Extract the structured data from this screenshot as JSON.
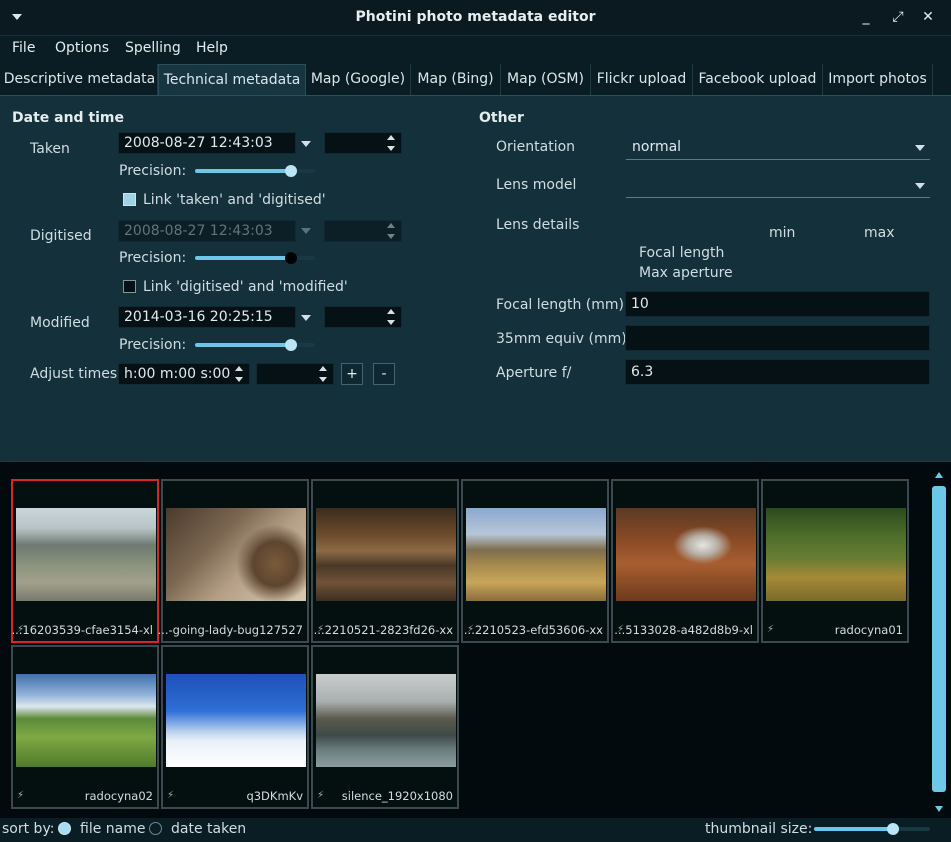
{
  "window": {
    "title": "Photini photo metadata editor"
  },
  "menu": {
    "items": [
      "File",
      "Options",
      "Spelling",
      "Help"
    ]
  },
  "tabs": [
    "Descriptive metadata",
    "Technical metadata",
    "Map (Google)",
    "Map (Bing)",
    "Map (OSM)",
    "Flickr upload",
    "Facebook upload",
    "Import photos"
  ],
  "datetime": {
    "heading": "Date and time",
    "taken_label": "Taken",
    "taken_value": "2008-08-27 12:43:03",
    "precision_label": "Precision:",
    "link_taken_digitised": "Link 'taken' and 'digitised'",
    "digitised_label": "Digitised",
    "digitised_value": "2008-08-27 12:43:03",
    "link_digitised_modified": "Link 'digitised' and 'modified'",
    "modified_label": "Modified",
    "modified_value": "2014-03-16 20:25:15",
    "adjust_label": "Adjust times",
    "adjust_value": "h:00 m:00 s:00",
    "plus": "+",
    "minus": "-"
  },
  "other": {
    "heading": "Other",
    "orientation_label": "Orientation",
    "orientation_value": "normal",
    "lens_model_label": "Lens model",
    "lens_model_value": "",
    "lens_details_label": "Lens details",
    "min_label": "min",
    "max_label": "max",
    "focal_length_row": "Focal length",
    "max_aperture_row": "Max aperture",
    "focal_mm_label": "Focal length (mm)",
    "focal_mm_value": "10",
    "equiv_label": "35mm equiv (mm)",
    "equiv_value": "",
    "aperture_label": "Aperture f/",
    "aperture_value": "6.3"
  },
  "thumbnails": [
    {
      "name": "...16203539-cfae3154-xl",
      "selected": true
    },
    {
      "name": "...-going-lady-bug127527",
      "selected": false
    },
    {
      "name": "...2210521-2823fd26-xx",
      "selected": false
    },
    {
      "name": "...2210523-efd53606-xx",
      "selected": false
    },
    {
      "name": "...5133028-a482d8b9-xl",
      "selected": false
    },
    {
      "name": "radocyna01",
      "selected": false
    },
    {
      "name": "radocyna02",
      "selected": false
    },
    {
      "name": "q3DKmKv",
      "selected": false
    },
    {
      "name": "silence_1920x1080",
      "selected": false
    }
  ],
  "status": {
    "sort_label": "sort by:",
    "file_name": "file name",
    "date_taken": "date taken",
    "thumb_size_label": "thumbnail size:"
  },
  "colors": {
    "accent": "#6cc7e8",
    "selection": "#d6262a",
    "background": "#0b1d24"
  }
}
